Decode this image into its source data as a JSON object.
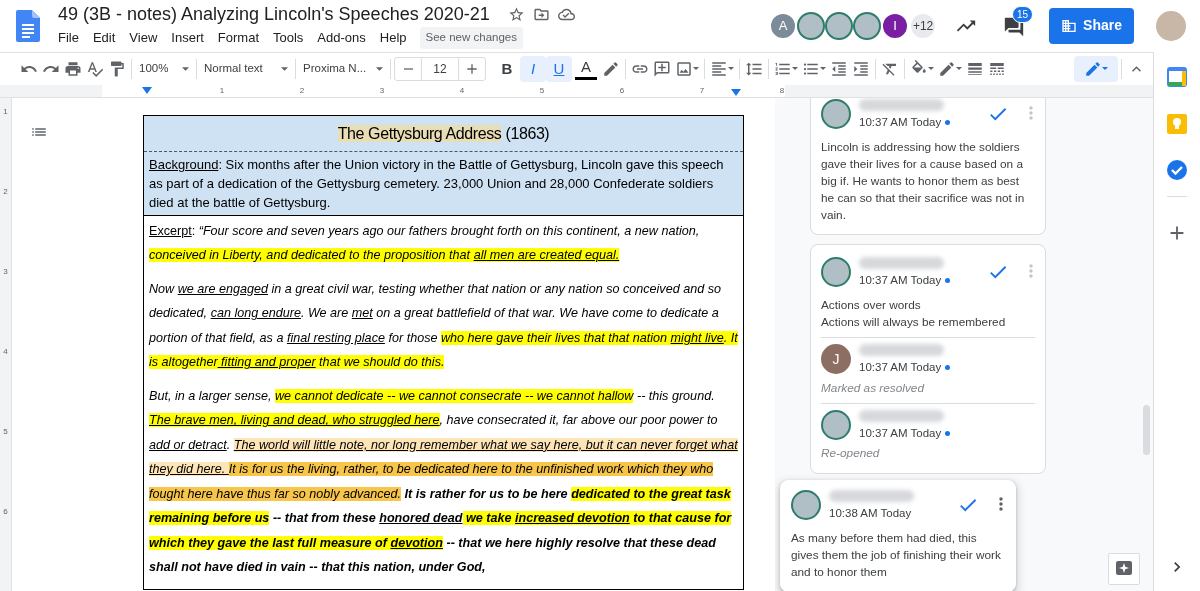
{
  "document": {
    "title": "49 (3B - notes) Analyzing Lincoln's Speeches 2020-21",
    "starred": false
  },
  "menu": [
    "File",
    "Edit",
    "View",
    "Insert",
    "Format",
    "Tools",
    "Add-ons",
    "Help"
  ],
  "see_new_changes": "See new changes",
  "collaborators": [
    {
      "kind": "letter",
      "letter": "A",
      "color": "#7b8b9a"
    },
    {
      "kind": "photo"
    },
    {
      "kind": "photo"
    },
    {
      "kind": "photo"
    },
    {
      "kind": "letter",
      "letter": "I",
      "color": "#7b1fa2"
    }
  ],
  "more_collaborators": "+12",
  "comment_count": "15",
  "share": "Share",
  "toolbar": {
    "zoom": "100%",
    "style": "Normal text",
    "font": "Proxima N...",
    "font_size": "12",
    "format_buttons": [
      {
        "kind": "bold",
        "label": "B",
        "selected": false
      },
      {
        "kind": "italic",
        "label": "I",
        "selected": true
      },
      {
        "kind": "underline",
        "label": "U",
        "selected": true
      }
    ],
    "text_color": "A"
  },
  "ruler": [
    "1",
    "2",
    "3",
    "4",
    "5",
    "6",
    "7",
    "8"
  ],
  "vertical_ruler": [
    "1",
    "2",
    "3",
    "4",
    "5",
    "6"
  ],
  "table": {
    "title": [
      {
        "t": "The Gettysburg Address",
        "kind": "plain",
        "color": "#e8ddb5"
      },
      {
        "t": " (1863)",
        "kind": "plain"
      }
    ],
    "background": [
      {
        "t": "Background",
        "kind": "label"
      },
      {
        "t": ": Six months after the Union victory in the Battle of Gettysburg, Lincoln gave this speech as part of a dedication of the Gettysburg cemetery. 23,000 Union and 28,000 Confederate soldiers died at the battle of Gettysburg.",
        "kind": "upright"
      }
    ],
    "excerpt": [
      [
        {
          "t": "Excerpt",
          "kind": "label"
        },
        {
          "t": ": ",
          "kind": "upright"
        },
        {
          "t": "“Four score and seven years ago our fathers brought forth on this continent, a new nation, ",
          "kind": "plain"
        },
        {
          "t": "conceived in Liberty, and dedicated to the proposition that ",
          "kind": "plain",
          "color": "#ffff00"
        },
        {
          "t": "all men are created equal.",
          "kind": "underlined",
          "color": "#ffff00"
        }
      ],
      [
        {
          "t": "Now ",
          "kind": "plain"
        },
        {
          "t": "we are engaged",
          "kind": "underlined"
        },
        {
          "t": " in a great civil war, testing whether that nation or any nation so conceived and so dedicated, ",
          "kind": "plain"
        },
        {
          "t": "can long endure",
          "kind": "underlined"
        },
        {
          "t": ". We are ",
          "kind": "plain"
        },
        {
          "t": "met",
          "kind": "underlined"
        },
        {
          "t": " on a great battlefield of that war. We have come to dedicate a portion of that field, as a ",
          "kind": "plain"
        },
        {
          "t": "final resting place",
          "kind": "underlined"
        },
        {
          "t": " for those ",
          "kind": "plain"
        },
        {
          "t": "who here gave their lives that that nation ",
          "kind": "plain",
          "color": "#ffff00"
        },
        {
          "t": "might live",
          "kind": "underlined",
          "color": "#ffff00"
        },
        {
          "t": ". It is altogether",
          "kind": "plain",
          "color": "#ffff00"
        },
        {
          "t": " fitting and proper",
          "kind": "underlined",
          "color": "#ffff00"
        },
        {
          "t": " that we should do this.",
          "kind": "plain",
          "color": "#ffff00"
        }
      ],
      [
        {
          "t": "But, in a larger sense, ",
          "kind": "plain"
        },
        {
          "t": "we cannot dedicate -- we cannot consecrate -- we cannot hallow",
          "kind": "plain",
          "color": "#ffff00"
        },
        {
          "t": " -- this ground. ",
          "kind": "plain"
        },
        {
          "t": "The brave men, living and dead, who struggled here",
          "kind": "underlined",
          "color": "#ffff00"
        },
        {
          "t": ", have consecrated it, far above our poor power to",
          "kind": "plain"
        },
        {
          "t": " add or detract",
          "kind": "underlined"
        },
        {
          "t": ". ",
          "kind": "plain"
        },
        {
          "t": "The world will little note, nor long remember what we say here, but it can never forget what they did here. ",
          "kind": "underlined",
          "color": "#fde5b8"
        },
        {
          "t": "It is for us the living, rather, to be dedicated here to the unfinished work which they who fought here have thus far so nobly advanced.",
          "kind": "plain",
          "color": "#f8c54b"
        },
        {
          "t": " **It is rather for us to be here** ",
          "kind": "plain"
        },
        {
          "t": "**dedicated to the great task remaining before us**",
          "kind": "plain",
          "color": "#ffff00"
        },
        {
          "t": " **-- that from these** ",
          "kind": "plain"
        },
        {
          "t": "**honored dead**",
          "kind": "underlined"
        },
        {
          "t": " **we take** ",
          "kind": "plain",
          "color": "#ffff00"
        },
        {
          "t": "**increased devotion**",
          "kind": "underlined",
          "color": "#ffff00"
        },
        {
          "t": " **to that cause for which they gave the last full measure of** ",
          "kind": "plain",
          "color": "#ffff00"
        },
        {
          "t": "**devotion**",
          "kind": "underlined",
          "color": "#ffff00"
        },
        {
          "t": " **-- that we here highly resolve that these dead shall not have died in vain -- that this nation, under God,**",
          "kind": "plain"
        }
      ]
    ]
  },
  "comments": [
    {
      "selected": false,
      "avatar": {
        "kind": "photo"
      },
      "time": "10:37 AM Today",
      "unread": true,
      "text": [
        "Lincoln is addressing how the soldiers gave their lives for a cause based on a big if. He wants to honor them as best he can so that their sacrifice was not in vain."
      ]
    },
    {
      "selected": false,
      "avatar": {
        "kind": "photo"
      },
      "time": "10:37 AM Today",
      "unread": true,
      "text": [
        "Actions over words",
        "Actions will always be remembered"
      ],
      "replies": [
        {
          "avatar": {
            "kind": "letter",
            "letter": "J",
            "color": "#8d6e63"
          },
          "time": "10:37 AM Today",
          "unread": true,
          "action": "Marked as resolved"
        },
        {
          "avatar": {
            "kind": "photo"
          },
          "time": "10:37 AM Today",
          "unread": true,
          "action": "Re-opened"
        }
      ]
    },
    {
      "selected": true,
      "avatar": {
        "kind": "photo"
      },
      "time": "10:38 AM Today",
      "unread": false,
      "text": [
        "As many before them had died, this gives them the job of finishing their work and to honor them"
      ]
    }
  ]
}
